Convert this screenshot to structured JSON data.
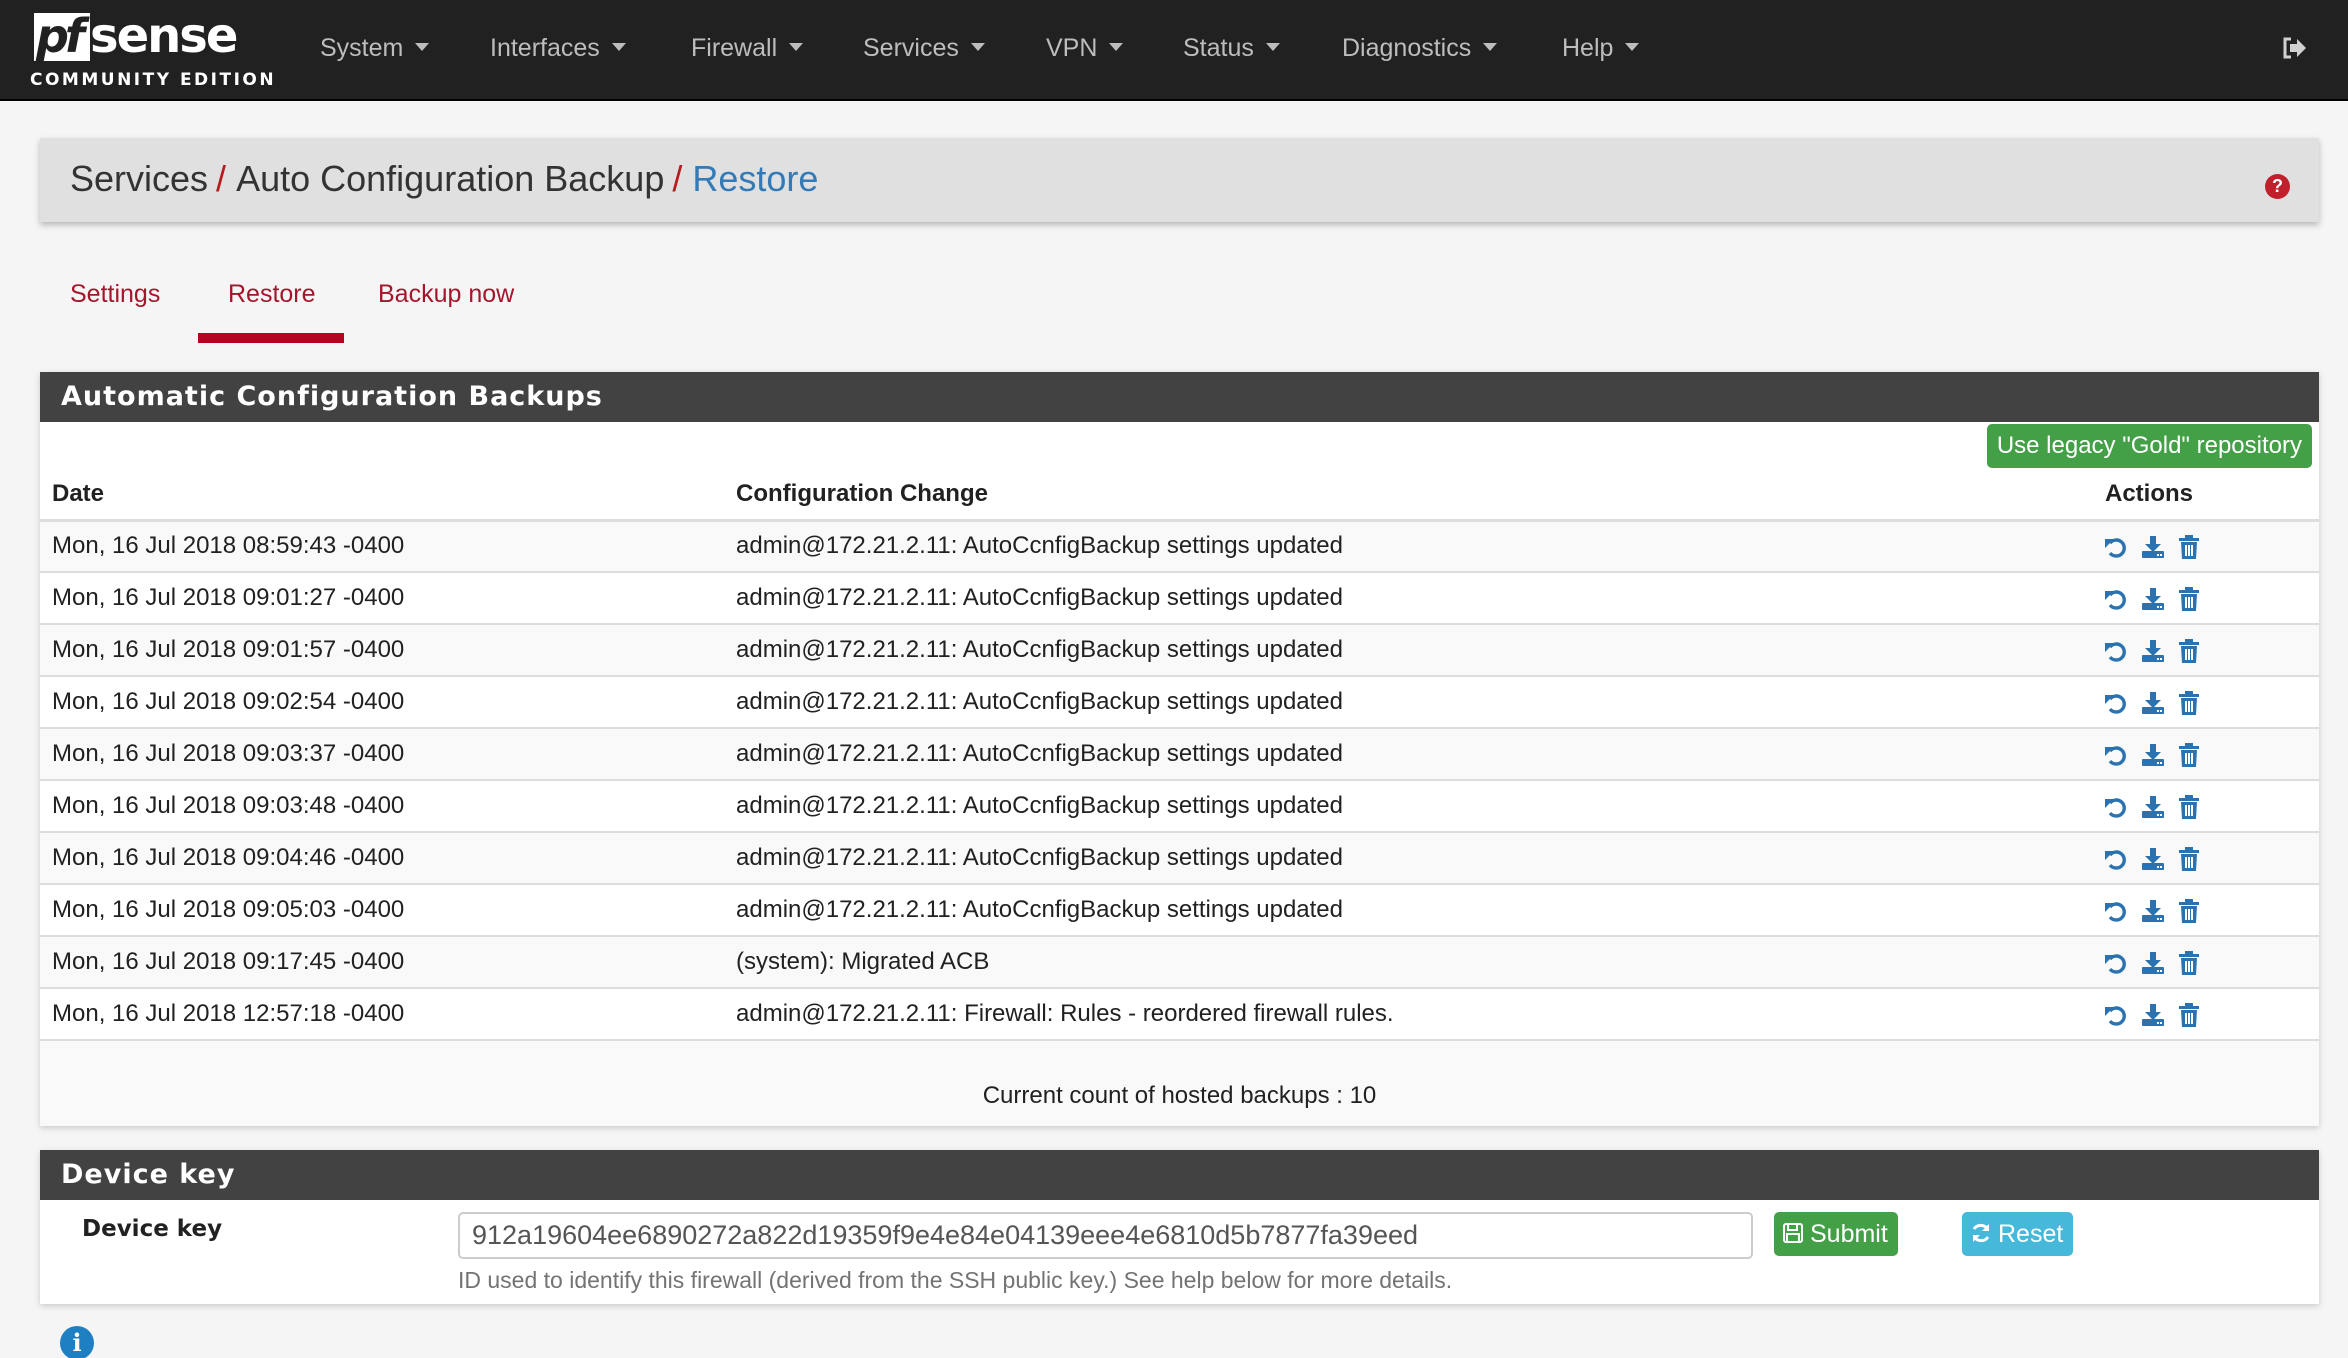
{
  "brand": {
    "logo_pf": "pf",
    "logo_sense": "sense",
    "edition": "COMMUNITY EDITION"
  },
  "nav": {
    "items": [
      {
        "label": "System"
      },
      {
        "label": "Interfaces"
      },
      {
        "label": "Firewall"
      },
      {
        "label": "Services"
      },
      {
        "label": "VPN"
      },
      {
        "label": "Status"
      },
      {
        "label": "Diagnostics"
      },
      {
        "label": "Help"
      }
    ],
    "logout_icon": "sign-out-icon"
  },
  "breadcrumb": {
    "items": [
      "Services",
      "Auto Configuration Backup",
      "Restore"
    ],
    "separator": "/",
    "help_icon": "question-circle-icon",
    "help_glyph": "?"
  },
  "tabs": {
    "items": [
      {
        "label": "Settings",
        "active": false
      },
      {
        "label": "Restore",
        "active": true
      },
      {
        "label": "Backup now",
        "active": false
      }
    ]
  },
  "backups_panel": {
    "title": "Automatic Configuration Backups",
    "legacy_button": "Use legacy \"Gold\" repository",
    "columns": [
      "Date",
      "Configuration Change",
      "Actions"
    ],
    "rows": [
      {
        "date": "Mon, 16 Jul 2018 08:59:43 -0400",
        "change": "admin@172.21.2.11: AutoCcnfigBackup settings updated"
      },
      {
        "date": "Mon, 16 Jul 2018 09:01:27 -0400",
        "change": "admin@172.21.2.11: AutoCcnfigBackup settings updated"
      },
      {
        "date": "Mon, 16 Jul 2018 09:01:57 -0400",
        "change": "admin@172.21.2.11: AutoCcnfigBackup settings updated"
      },
      {
        "date": "Mon, 16 Jul 2018 09:02:54 -0400",
        "change": "admin@172.21.2.11: AutoCcnfigBackup settings updated"
      },
      {
        "date": "Mon, 16 Jul 2018 09:03:37 -0400",
        "change": "admin@172.21.2.11: AutoCcnfigBackup settings updated"
      },
      {
        "date": "Mon, 16 Jul 2018 09:03:48 -0400",
        "change": "admin@172.21.2.11: AutoCcnfigBackup settings updated"
      },
      {
        "date": "Mon, 16 Jul 2018 09:04:46 -0400",
        "change": "admin@172.21.2.11: AutoCcnfigBackup settings updated"
      },
      {
        "date": "Mon, 16 Jul 2018 09:05:03 -0400",
        "change": "admin@172.21.2.11: AutoCcnfigBackup settings updated"
      },
      {
        "date": "Mon, 16 Jul 2018 09:17:45 -0400",
        "change": "(system): Migrated ACB"
      },
      {
        "date": "Mon, 16 Jul 2018 12:57:18 -0400",
        "change": "admin@172.21.2.11: Firewall: Rules - reordered firewall rules."
      }
    ],
    "row_actions": [
      "restore-icon",
      "download-icon",
      "trash-icon"
    ],
    "count_text": "Current count of hosted backups : 10"
  },
  "device_key_panel": {
    "title": "Device key",
    "label": "Device key",
    "value": "912a19604ee6890272a822d19359f9e4e84e04139eee4e6810d5b7877fa39eed",
    "help_text": "ID used to identify this firewall (derived from the SSH public key.) See help below for more details.",
    "submit_label": "Submit",
    "reset_label": "Reset"
  },
  "info_icon": "info-circle-icon",
  "colors": {
    "navbar": "#212121",
    "panel_heading": "#424242",
    "accent_red": "#b8001f",
    "link_blue": "#337ab7",
    "success_green": "#43a047",
    "info_cyan": "#46b8da",
    "action_icon_blue": "#2a72b0"
  }
}
